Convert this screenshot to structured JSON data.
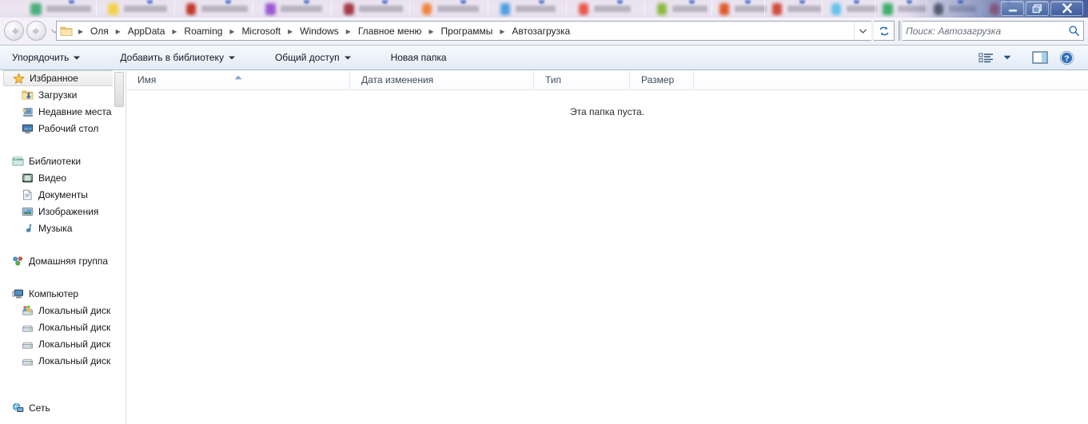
{
  "window": {
    "controls": {
      "minimize_label": "Свернуть",
      "maximize_label": "Развернуть",
      "close_label": "Закрыть"
    }
  },
  "navigation": {
    "back_label": "Назад",
    "forward_label": "Вперед",
    "recent_pages_label": "Последние страницы",
    "refresh_label": "Обновить"
  },
  "address_bar": {
    "crumbs": [
      "Оля",
      "AppData",
      "Roaming",
      "Microsoft",
      "Windows",
      "Главное меню",
      "Программы",
      "Автозагрузка"
    ],
    "separator": "▸"
  },
  "search": {
    "placeholder": "Поиск: Автозагрузка",
    "value": ""
  },
  "toolbar": {
    "organize": "Упорядочить",
    "add_to_library": "Добавить в библиотеку",
    "share_with": "Общий доступ",
    "new_folder": "Новая папка",
    "caret": "▼",
    "change_view_label": "Изменить представление",
    "preview_pane_label": "Область предварительного просмотра",
    "help_label": "Справка"
  },
  "nav_pane": {
    "groups": [
      {
        "header": "Избранное",
        "header_icon": "star-icon",
        "selected": true,
        "items": [
          {
            "label": "Загрузки",
            "icon": "downloads-folder-icon"
          },
          {
            "label": "Недавние места",
            "icon": "recent-places-icon"
          },
          {
            "label": "Рабочий стол",
            "icon": "desktop-icon"
          }
        ]
      },
      {
        "header": "Библиотеки",
        "header_icon": "libraries-icon",
        "selected": false,
        "items": [
          {
            "label": "Видео",
            "icon": "video-library-icon"
          },
          {
            "label": "Документы",
            "icon": "documents-library-icon"
          },
          {
            "label": "Изображения",
            "icon": "pictures-library-icon"
          },
          {
            "label": "Музыка",
            "icon": "music-library-icon"
          }
        ]
      },
      {
        "header": "Домашняя группа",
        "header_icon": "homegroup-icon",
        "selected": false,
        "items": []
      },
      {
        "header": "Компьютер",
        "header_icon": "computer-icon",
        "selected": false,
        "items": [
          {
            "label": "Локальный диск (C",
            "icon": "system-drive-icon"
          },
          {
            "label": "Локальный диск (D",
            "icon": "drive-icon"
          },
          {
            "label": "Локальный диск (E:",
            "icon": "drive-icon"
          },
          {
            "label": "Локальный диск (F:",
            "icon": "drive-icon"
          }
        ]
      },
      {
        "header": "Сеть",
        "header_icon": "network-icon",
        "selected": false,
        "items": []
      }
    ]
  },
  "file_list": {
    "columns": [
      {
        "label": "Имя",
        "sorted": true,
        "sort_dir": "asc"
      },
      {
        "label": "Дата изменения",
        "sorted": false,
        "sort_dir": ""
      },
      {
        "label": "Тип",
        "sorted": false,
        "sort_dir": ""
      },
      {
        "label": "Размер",
        "sorted": false,
        "sort_dir": ""
      }
    ],
    "rows": [],
    "empty_message": "Эта папка пуста."
  },
  "colors": {
    "accent": "#2a6099",
    "toolbar_top": "#f6f9fd",
    "toolbar_bottom": "#e2ebf7",
    "address_border": "#9ba7b7",
    "header_text": "#3f4b5c"
  }
}
